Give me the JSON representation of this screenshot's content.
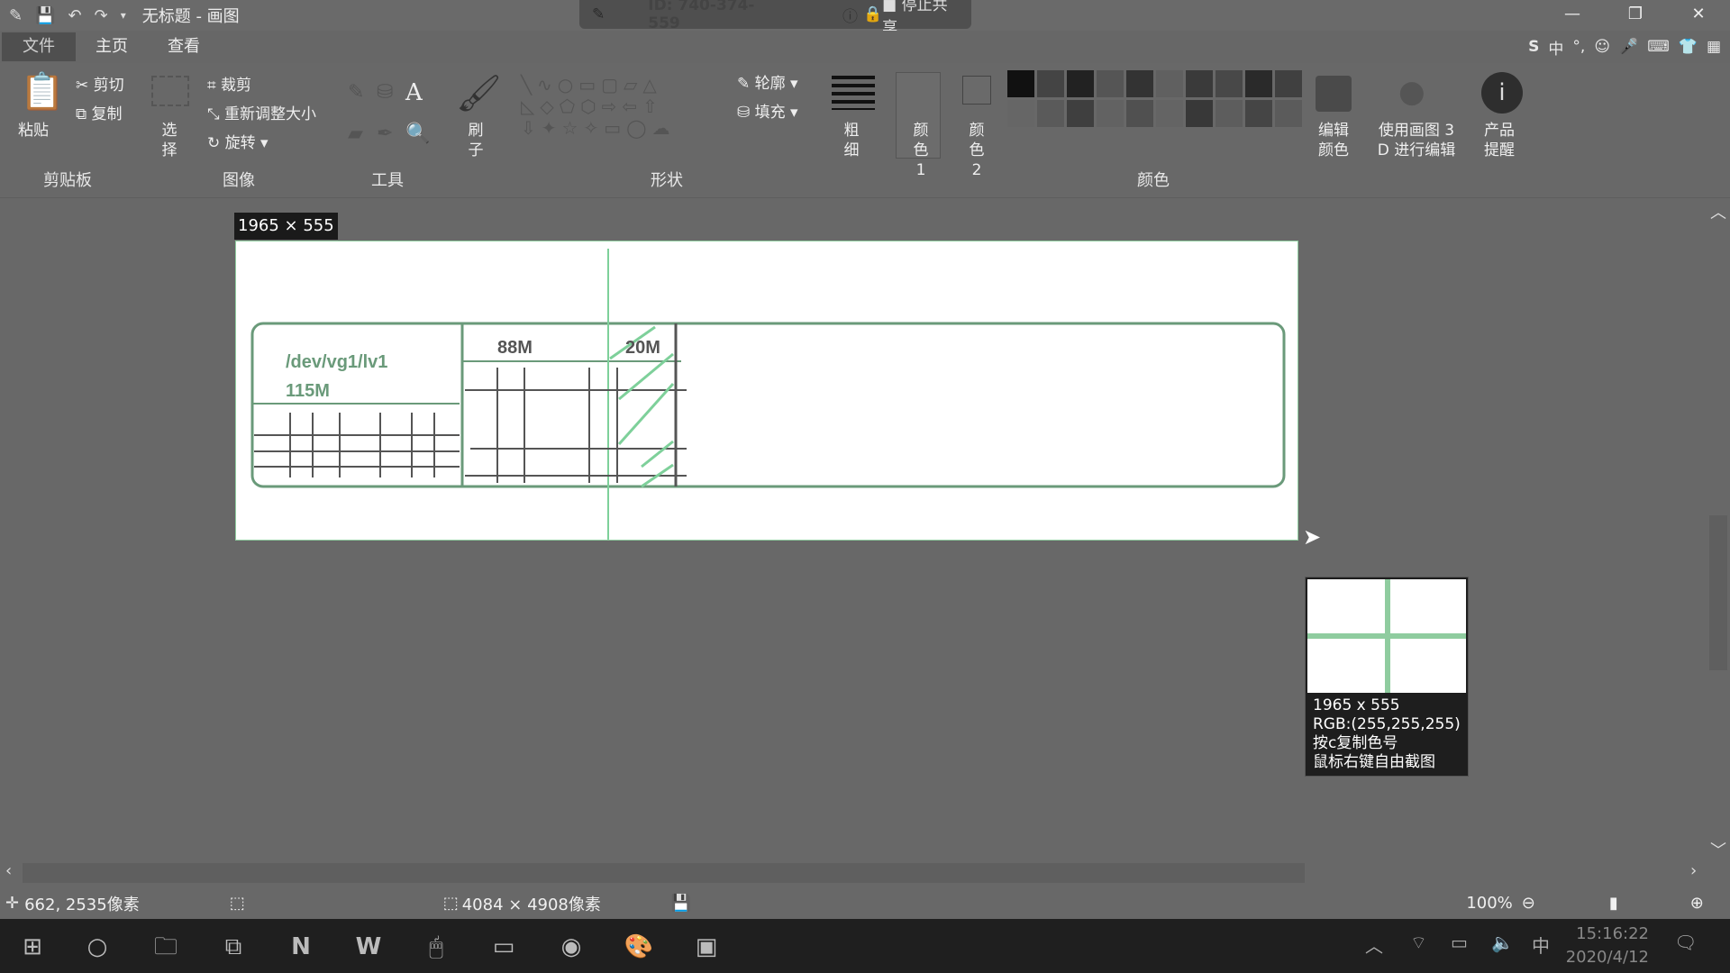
{
  "window": {
    "title": "无标题 - 画图",
    "controls": [
      "—",
      "❐",
      "✕"
    ]
  },
  "share_bar": {
    "id_text": "ID: 740-374-559",
    "stop_label": "停止共享"
  },
  "menu": {
    "file": "文件",
    "tabs": [
      "主页",
      "查看"
    ]
  },
  "ime_bar": {
    "lang": "中"
  },
  "ribbon": {
    "clipboard": {
      "paste": "粘贴",
      "cut": "剪切",
      "copy": "复制",
      "label": "剪贴板"
    },
    "image": {
      "select": "选择",
      "crop": "裁剪",
      "resize": "重新调整大小",
      "rotate": "旋转",
      "label": "图像"
    },
    "tools": {
      "label": "工具"
    },
    "brush": {
      "label": "刷子"
    },
    "shapes": {
      "outline": "轮廓",
      "fill": "填充",
      "label": "形状"
    },
    "size": {
      "label": "粗细"
    },
    "color1": {
      "label": "颜色 1"
    },
    "color2": {
      "label": "颜色 2"
    },
    "colors": {
      "label": "颜色"
    },
    "edit_colors": {
      "label": "编辑颜色"
    },
    "paint3d": {
      "label": "使用画图 3 D 进行编辑"
    },
    "product_alert": {
      "label": "产品提醒"
    }
  },
  "canvas": {
    "size_tag": "1965 × 555",
    "drawing": {
      "lv_name": "/dev/vg1/lv1",
      "lv_size": "115M",
      "seg2": "88M",
      "seg3": "20M"
    }
  },
  "magnifier": {
    "size": "1965 x 555",
    "rgb": "RGB:(255,255,255)",
    "hint1": "按c复制色号",
    "hint2": "鼠标右键自由截图"
  },
  "status": {
    "cursor_pos": "662, 2535像素",
    "image_size": "4084 × 4908像素",
    "zoom": "100%"
  },
  "taskbar": {
    "time": "15:16:22",
    "date": "2020/4/12",
    "ime": "中"
  }
}
